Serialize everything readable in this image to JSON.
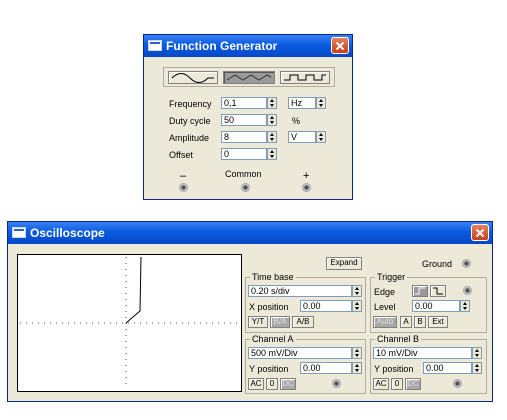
{
  "function_generator": {
    "title": "Function Generator",
    "waveforms": [
      "sine-wave-icon",
      "triangle-wave-icon",
      "square-wave-icon"
    ],
    "selected_waveform": "triangle",
    "frequency": {
      "label": "Frequency",
      "value": "0,1",
      "unit": "Hz"
    },
    "duty_cycle": {
      "label": "Duty cycle",
      "value": "50",
      "unit": "%"
    },
    "amplitude": {
      "label": "Amplitude",
      "value": "8",
      "unit": "V"
    },
    "offset": {
      "label": "Offset",
      "value": "0"
    },
    "terminals": {
      "minus": "–",
      "common": "Common",
      "plus": "+"
    }
  },
  "oscilloscope": {
    "title": "Oscilloscope",
    "expand_label": "Expand",
    "ground_label": "Ground",
    "time_base": {
      "title": "Time base",
      "scale": "0.20 s/div",
      "x_position_label": "X position",
      "x_position": "0.00",
      "modes": [
        "Y/T",
        "B/A",
        "A/B"
      ]
    },
    "trigger": {
      "title": "Trigger",
      "edge_label": "Edge",
      "level_label": "Level",
      "level": "0.00",
      "sources": [
        "Auto",
        "A",
        "B",
        "Ext"
      ]
    },
    "channel_a": {
      "title": "Channel A",
      "scale": "500 mV/Div",
      "y_position_label": "Y position",
      "y_position": "0.00",
      "coupling": [
        "AC",
        "0",
        "DC"
      ]
    },
    "channel_b": {
      "title": "Channel B",
      "scale": "10 mV/Div",
      "y_position_label": "Y position",
      "y_position": "0.00",
      "coupling": [
        "AC",
        "0",
        "DC"
      ]
    }
  },
  "colors": {
    "titlebar": "#0a5be0",
    "window_bg": "#ece9d8",
    "close_button": "#c8411a",
    "screen_bg": "#ffffff",
    "trace": "#000000"
  }
}
